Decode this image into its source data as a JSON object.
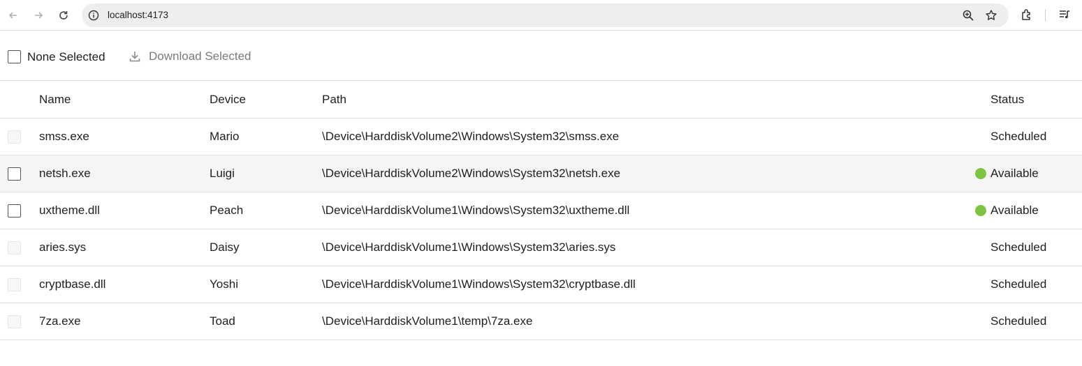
{
  "browser": {
    "url": "localhost:4173"
  },
  "toolbar": {
    "selection_label": "None Selected",
    "download_label": "Download Selected"
  },
  "table": {
    "headers": {
      "name": "Name",
      "device": "Device",
      "path": "Path",
      "status": "Status"
    },
    "rows": [
      {
        "name": "smss.exe",
        "device": "Mario",
        "path": "\\Device\\HarddiskVolume2\\Windows\\System32\\smss.exe",
        "status": "Scheduled",
        "selectable": false
      },
      {
        "name": "netsh.exe",
        "device": "Luigi",
        "path": "\\Device\\HarddiskVolume2\\Windows\\System32\\netsh.exe",
        "status": "Available",
        "selectable": true
      },
      {
        "name": "uxtheme.dll",
        "device": "Peach",
        "path": "\\Device\\HarddiskVolume1\\Windows\\System32\\uxtheme.dll",
        "status": "Available",
        "selectable": true
      },
      {
        "name": "aries.sys",
        "device": "Daisy",
        "path": "\\Device\\HarddiskVolume1\\Windows\\System32\\aries.sys",
        "status": "Scheduled",
        "selectable": false
      },
      {
        "name": "cryptbase.dll",
        "device": "Yoshi",
        "path": "\\Device\\HarddiskVolume1\\Windows\\System32\\cryptbase.dll",
        "status": "Scheduled",
        "selectable": false
      },
      {
        "name": "7za.exe",
        "device": "Toad",
        "path": "\\Device\\HarddiskVolume1\\temp\\7za.exe",
        "status": "Scheduled",
        "selectable": false
      }
    ]
  },
  "colors": {
    "available_dot": "#7cc442",
    "hover_row": "#f5f5f5"
  },
  "icons": [
    "back-arrow-icon",
    "forward-arrow-icon",
    "reload-icon",
    "info-icon",
    "zoom-icon",
    "star-icon",
    "extensions-icon",
    "media-icon",
    "download-icon",
    "status-dot-icon"
  ]
}
